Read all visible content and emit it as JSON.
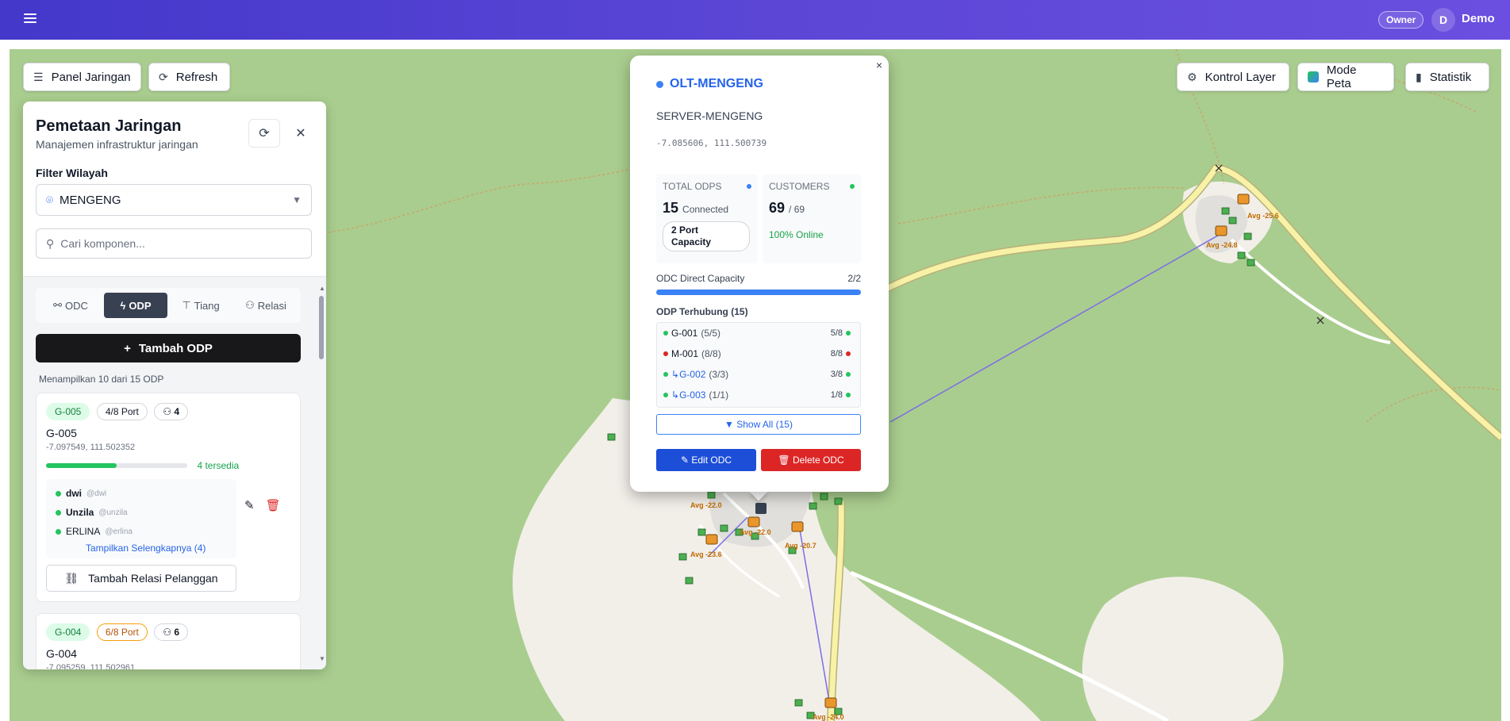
{
  "header": {
    "role_badge": "Owner",
    "avatar_initial": "D",
    "user_name": "Demo"
  },
  "toolbar": {
    "panel_label": "Panel Jaringan",
    "refresh_label": "Refresh",
    "layer_label": "Kontrol Layer",
    "map_mode_label": "Mode Peta",
    "stats_label": "Statistik"
  },
  "panel": {
    "title": "Pemetaan Jaringan",
    "subtitle": "Manajemen infrastruktur jaringan",
    "filter_label": "Filter Wilayah",
    "filter_value": "MENGENG",
    "search_placeholder": "Cari komponen...",
    "tabs": [
      {
        "label": "ODC",
        "active": false
      },
      {
        "label": "ODP",
        "active": true
      },
      {
        "label": "Tiang",
        "active": false
      },
      {
        "label": "Relasi",
        "active": false
      }
    ],
    "add_label": "Tambah ODP",
    "showing": "Menampilkan 10 dari 15 ODP",
    "cards": [
      {
        "code": "G-005",
        "port": "4/8 Port",
        "customers": "4",
        "name": "G-005",
        "coord": "-7.097549, 111.502352",
        "available": "4 tersedia",
        "fill_fraction": 0.5,
        "customer_list": [
          {
            "name": "dwi",
            "user": "@dwi"
          },
          {
            "name": "Unzila",
            "user": "@unzila"
          },
          {
            "name": "ERLINA",
            "user": "@erlina"
          }
        ],
        "more": "Tampilkan Selengkapnya (4)",
        "relation_button": "Tambah Relasi Pelanggan"
      },
      {
        "code": "G-004",
        "port": "6/8 Port",
        "customers": "6",
        "name": "G-004",
        "coord": "-7.095259, 111.502961"
      }
    ]
  },
  "popup": {
    "title": "OLT-MENGENG",
    "server": "SERVER-MENGENG",
    "coord": "-7.085606, 111.500739",
    "total_odps_label": "TOTAL ODPS",
    "total_odps_value": "15",
    "total_odps_suffix": "Connected",
    "port_capacity": "2 Port Capacity",
    "customers_label": "CUSTOMERS",
    "customers_value": "69",
    "customers_suffix": "/ 69",
    "online": "100% Online",
    "capacity_label": "ODC Direct Capacity",
    "capacity_value": "2/2",
    "capacity_fraction": 1.0,
    "odp_header": "ODP Terhubung (15)",
    "odps": [
      {
        "name": "G-001",
        "count": "(5/5)",
        "ports": "5/8",
        "status": "green",
        "child": false
      },
      {
        "name": "M-001",
        "count": "(8/8)",
        "ports": "8/8",
        "status": "red",
        "child": false
      },
      {
        "name": "G-002",
        "count": "(3/3)",
        "ports": "3/8",
        "status": "green",
        "child": true
      },
      {
        "name": "G-003",
        "count": "(1/1)",
        "ports": "1/8",
        "status": "green",
        "child": true
      }
    ],
    "show_all": "▼ Show All (15)",
    "edit_label": "Edit ODC",
    "delete_label": "Delete ODC",
    "close_icon": "×"
  },
  "map": {
    "labels": [
      "Avg -25.6",
      "Avg -24.8",
      "Avg -22.0",
      "Avg -22.0",
      "Avg -20.7",
      "Avg -23.6",
      "Avg -24.0"
    ]
  },
  "colors": {
    "header_start": "#4338ca",
    "header_end": "#6a4fe0",
    "map_green": "#a9cd8e",
    "map_sand": "#f2efe9",
    "road_yellow": "#f7f2a6",
    "accent_blue": "#2563eb",
    "danger_red": "#dc2626",
    "success_green": "#22c55e"
  }
}
